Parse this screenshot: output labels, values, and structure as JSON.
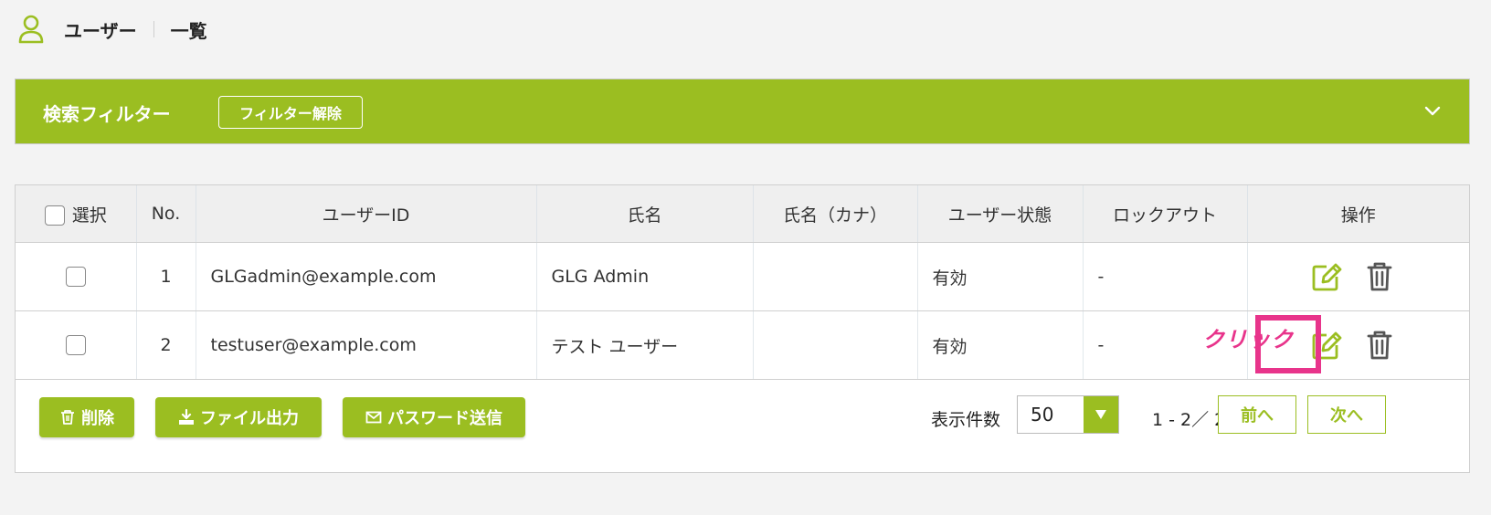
{
  "header": {
    "title": "ユーザー",
    "subtitle": "一覧"
  },
  "filter": {
    "label": "検索フィルター",
    "clear_label": "フィルター解除"
  },
  "table": {
    "columns": [
      "選択",
      "No.",
      "ユーザーID",
      "氏名",
      "氏名（カナ）",
      "ユーザー状態",
      "ロックアウト",
      "操作"
    ],
    "rows": [
      {
        "no": "1",
        "user_id": "GLGadmin@example.com",
        "name": "GLG Admin",
        "kana": "",
        "status": "有効",
        "lockout": "-"
      },
      {
        "no": "2",
        "user_id": "testuser@example.com",
        "name": "テスト ユーザー",
        "kana": "",
        "status": "有効",
        "lockout": "-"
      }
    ]
  },
  "annotation": {
    "click_label": "クリック"
  },
  "actions": {
    "delete_label": "削除",
    "export_label": "ファイル出力",
    "password_label": "パスワード送信"
  },
  "pagination": {
    "per_page_label": "表示件数",
    "per_page_value": "50",
    "range": "1 - 2／ 2",
    "prev_label": "前へ",
    "next_label": "次へ"
  },
  "colors": {
    "accent": "#9bbe21",
    "highlight": "#e8348b"
  }
}
